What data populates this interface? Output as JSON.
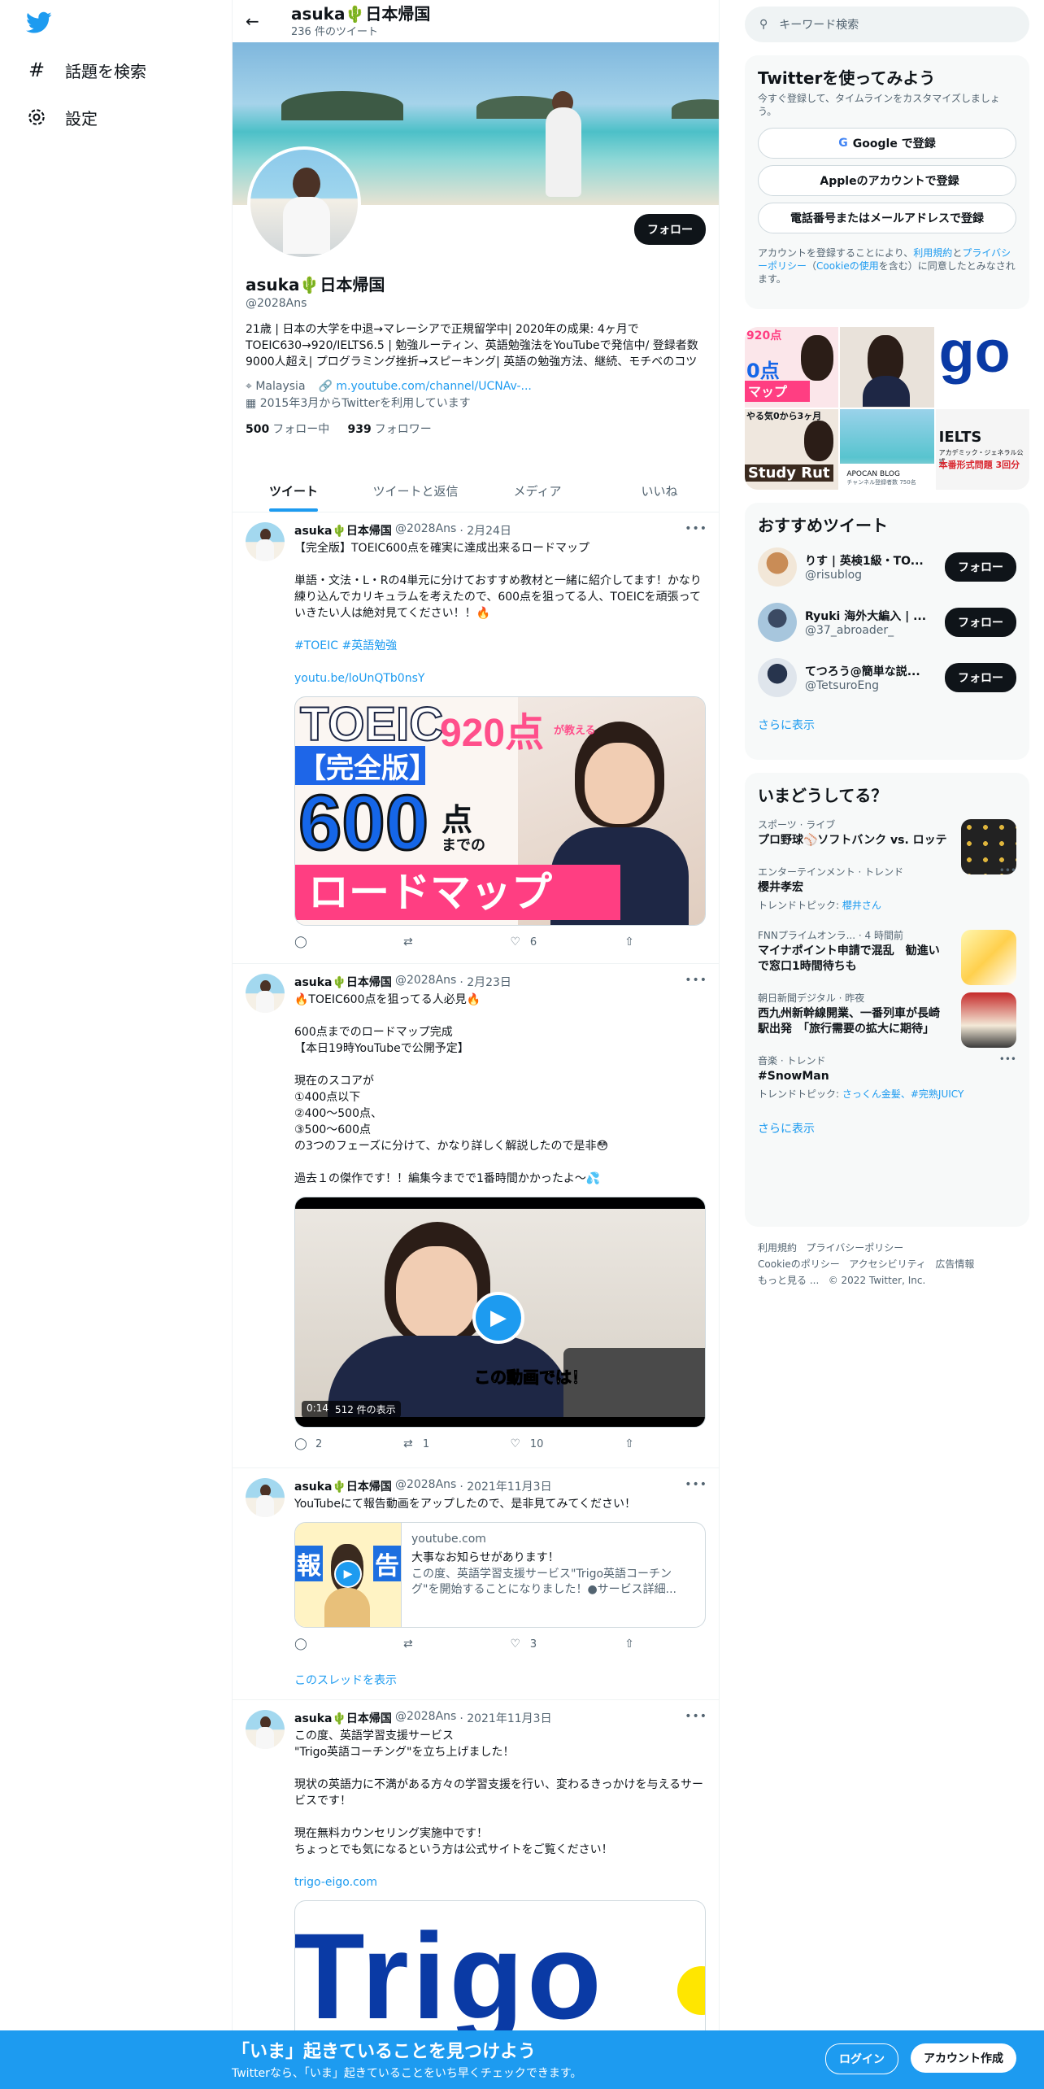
{
  "nav": {
    "explore_label": "話題を検索",
    "settings_label": "設定"
  },
  "header": {
    "title": "asuka🌵日本帰国",
    "tweet_count": "236 件のツイート"
  },
  "profile": {
    "name": "asuka🌵日本帰国",
    "handle": "@2028Ans",
    "follow_label": "フォロー",
    "bio": "21歳 | 日本の大学を中退→マレーシアで正規留学中| 2020年の成果: 4ヶ月でTOEIC630→920/IELTS6.5 | 勉強ルーティン、英語勉強法をYouTubeで発信中/ 登録者数9000人超え| プログラミング挫折→スピーキング| 英語の勉強方法、継続、モチベのコツ",
    "location": "Malaysia",
    "url": "m.youtube.com/channel/UCNAv-...",
    "joined": "2015年3月からTwitterを利用しています",
    "following_count": "500",
    "following_label": "フォロー中",
    "followers_count": "939",
    "followers_label": "フォロワー"
  },
  "tabs": [
    "ツイート",
    "ツイートと返信",
    "メディア",
    "いいね"
  ],
  "tweets": [
    {
      "name": "asuka🌵日本帰国",
      "handle": "@2028Ans",
      "date": "· 2月24日",
      "text": "【完全版】TOEIC600点を確実に達成出来るロードマップ\n\n単語・文法・L・Rの4単元に分けておすすめ教材と一緒に紹介してます！かなり練り込んでカリキュラムを考えたので、600点を狙ってる人、TOEICを頑張っていきたい人は絶対見てください！！🔥",
      "hashtags": "#TOEIC #英語勉強",
      "link": "youtu.be/loUnQTb0nsY",
      "thumb_line1": "TOEIC",
      "thumb_score": "920点",
      "thumb_small": "が教える",
      "thumb_line2": "【完全版】",
      "thumb_big": "600",
      "thumb_unit": "点",
      "thumb_made": "までの",
      "thumb_line3": "ロードマップ",
      "replies": "",
      "retweets": "",
      "likes": "6"
    },
    {
      "name": "asuka🌵日本帰国",
      "handle": "@2028Ans",
      "date": "· 2月23日",
      "text": "🔥TOEIC600点を狙ってる人必見🔥\n\n600点までのロードマップ完成\n【本日19時YouTubeで公開予定】\n\n現在のスコアが\n①400点以下\n②400〜500点、\n③500〜600点\nの3つのフェーズに分けて、かなり詳しく解説したので是非😳\n\n過去１の傑作です！！編集今までで1番時間かかったよ〜💦",
      "video_caption": "この動画では！",
      "video_time": "0:14",
      "video_views": "512 件の表示",
      "replies": "2",
      "retweets": "1",
      "likes": "10"
    },
    {
      "name": "asuka🌵日本帰国",
      "handle": "@2028Ans",
      "date": "· 2021年11月3日",
      "text": "YouTubeにて報告動画をアップしたので、是非見てみてください！",
      "card_domain": "youtube.com",
      "card_title": "大事なお知らせがあります！",
      "card_desc": "この度、英語学習支援サービス\"Trigo英語コーチング\"を開始することになりました！●サービス詳細...",
      "card_thumb_left": "報",
      "card_thumb_right": "告",
      "replies": "",
      "retweets": "",
      "likes": "3",
      "thread_label": "このスレッドを表示"
    },
    {
      "name": "asuka🌵日本帰国",
      "handle": "@2028Ans",
      "date": "· 2021年11月3日",
      "text": "この度、英語学習支援サービス\n\"Trigo英語コーチング\"を立ち上げました！\n\n現状の英語力に不満がある方々の学習支援を行い、変わるきっかけを与えるサービスです！\n\n現在無料カウンセリング実施中です！\nちょっとでも気になるという方は公式サイトをご覧ください！",
      "link": "trigo-eigo.com",
      "logo_text": "Trigo"
    }
  ],
  "sidebar": {
    "search_placeholder": "キーワード検索",
    "signup_title": "Twitterを使ってみよう",
    "signup_sub": "今すぐ登録して、タイムラインをカスタマイズしましょう。",
    "google_btn": "Google で登録",
    "apple_btn": "Appleのアカウントで登録",
    "phone_btn": "電話番号またはメールアドレスで登録",
    "terms_pre": "アカウントを登録することにより、",
    "terms_link1": "利用規約",
    "terms_mid": "と",
    "terms_link2": "プライバシーポリシー",
    "terms_mid2": "（",
    "terms_link3": "Cookieの使用",
    "terms_post": "を含む）に同意したとみなされます。",
    "media_texts": {
      "m1_top": "920点",
      "m1_mid": "0点",
      "m1_bottom": "マップ",
      "m3": "go",
      "m4a": "やる気0から3ヶ月",
      "m4b": "Study Rut",
      "m5": "APOCAN BLOG",
      "m5_sub": "チャンネル登録者数 750名",
      "m6": "IELTS",
      "m6_sub": "アカデミック・ジェネラル公式",
      "m6_sub2": "本番形式問題 3回分"
    },
    "recommend_title": "おすすめツイート",
    "recommend": [
      {
        "name": "りす | 英検1級・TO...",
        "handle": "@risublog",
        "btn": "フォロー"
      },
      {
        "name": "Ryuki 海外大編入 | ...",
        "handle": "@37_abroader_",
        "btn": "フォロー"
      },
      {
        "name": "てつろう@簡単な説...",
        "handle": "@TetsuroEng",
        "btn": "フォロー"
      }
    ],
    "show_more": "さらに表示",
    "trends_title": "いまどうしてる？",
    "trends": [
      {
        "cat": "スポーツ · ライブ",
        "title": "プロ野球⚾ソフトバンク vs. ロッテ",
        "sub": ""
      },
      {
        "cat": "エンターテインメント · トレンド",
        "title": "櫻井孝宏",
        "sub_pre": "トレンドトピック: ",
        "sub_link": "櫻井さん"
      },
      {
        "cat": "FNNプライムオンラ... · 4 時間前",
        "title": "マイナポイント申請で混乱　勧進いで窓口1時間待ちも",
        "sub": ""
      },
      {
        "cat": "朝日新聞デジタル · 昨夜",
        "title": "西九州新幹線開業、一番列車が長崎駅出発　「旅行需要の拡大に期待」",
        "sub": ""
      },
      {
        "cat": "音楽 · トレンド",
        "title": "#SnowMan",
        "sub_pre": "トレンドトピック: ",
        "sub_link": "さっくん金髪、#完熟JUICY"
      }
    ],
    "trends_show_more": "さらに表示",
    "footer": [
      "利用規約",
      "プライバシーポリシー",
      "Cookieのポリシー",
      "アクセシビリティ",
      "広告情報",
      "もっと見る ...",
      "© 2022 Twitter, Inc."
    ]
  },
  "bottom_bar": {
    "title": "「いま」起きていることを見つけよう",
    "sub": "Twitterなら、「いま」起きていることをいち早くチェックできます。",
    "login": "ログイン",
    "signup": "アカウント作成"
  },
  "colors": {
    "accent": "#1d9bf0",
    "text": "#0f1419",
    "muted": "#536471"
  }
}
